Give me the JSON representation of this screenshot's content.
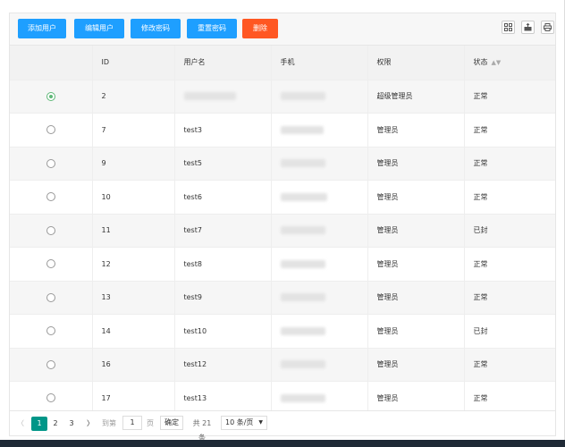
{
  "toolbar": {
    "add_user": "添加用户",
    "edit_user": "编辑用户",
    "change_password": "修改密码",
    "reset_password": "重置密码",
    "delete": "删除",
    "icons": [
      "columns-icon",
      "export-icon",
      "print-icon"
    ]
  },
  "table": {
    "headers": {
      "id": "ID",
      "username": "用户名",
      "phone": "手机",
      "role": "权限",
      "status": "状态"
    },
    "rows": [
      {
        "selected": true,
        "id": "2",
        "username": "",
        "role": "超级管理员",
        "status": "正常"
      },
      {
        "selected": false,
        "id": "7",
        "username": "test3",
        "role": "管理员",
        "status": "正常"
      },
      {
        "selected": false,
        "id": "9",
        "username": "test5",
        "role": "管理员",
        "status": "正常"
      },
      {
        "selected": false,
        "id": "10",
        "username": "test6",
        "role": "管理员",
        "status": "正常"
      },
      {
        "selected": false,
        "id": "11",
        "username": "test7",
        "role": "管理员",
        "status": "已封"
      },
      {
        "selected": false,
        "id": "12",
        "username": "test8",
        "role": "管理员",
        "status": "正常"
      },
      {
        "selected": false,
        "id": "13",
        "username": "test9",
        "role": "管理员",
        "status": "正常"
      },
      {
        "selected": false,
        "id": "14",
        "username": "test10",
        "role": "管理员",
        "status": "已封"
      },
      {
        "selected": false,
        "id": "16",
        "username": "test12",
        "role": "管理员",
        "status": "正常"
      },
      {
        "selected": false,
        "id": "17",
        "username": "test13",
        "role": "管理员",
        "status": "正常"
      }
    ]
  },
  "pagination": {
    "prev": "〈",
    "pages": [
      "1",
      "2",
      "3"
    ],
    "current": "1",
    "next": "〉",
    "goto_label": "到第",
    "goto_value": "1",
    "page_unit": "页",
    "confirm": "确定",
    "total": "共 21 条",
    "page_size": "10 条/页"
  },
  "colors": {
    "primary_button": "#1e9fff",
    "danger_button": "#ff5722",
    "current_page": "#009688",
    "selected_radio": "#5fb878"
  }
}
